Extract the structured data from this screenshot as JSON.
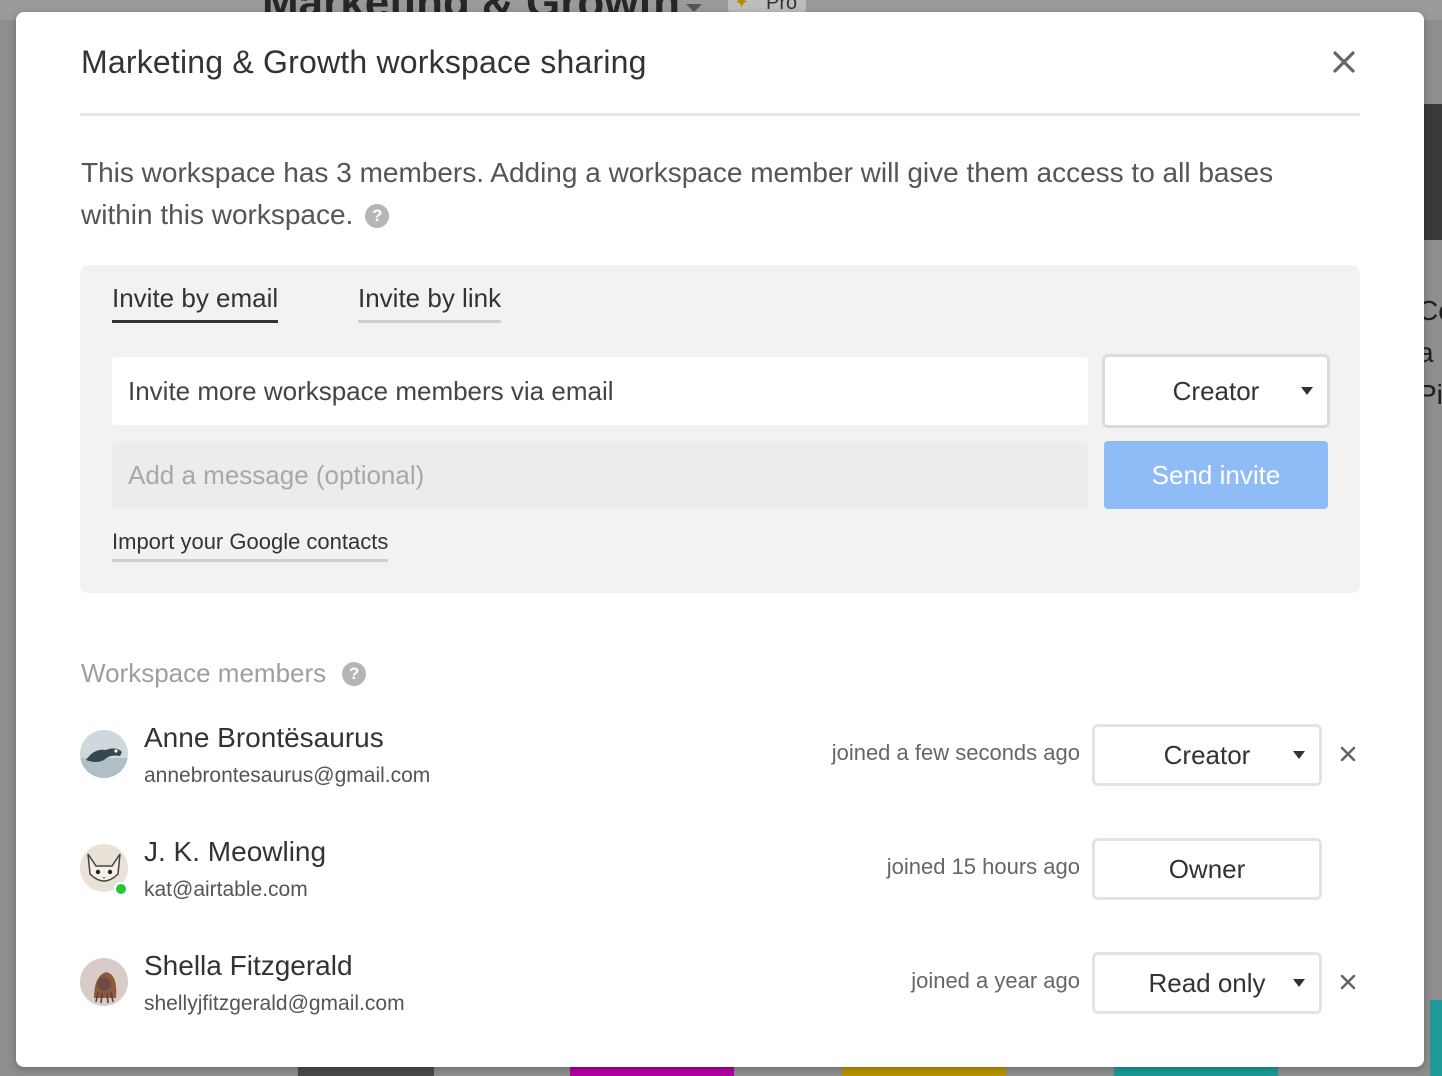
{
  "background": {
    "title": "Marketing & Growth",
    "plan_badge": "Pro",
    "right_fragments": [
      "Co",
      "a",
      "Pi"
    ]
  },
  "modal": {
    "title": "Marketing & Growth workspace sharing",
    "description": "This workspace has 3 members. Adding a workspace member will give them access to all bases within this workspace.",
    "help_icon": "?"
  },
  "invite": {
    "tabs": [
      {
        "label": "Invite by email",
        "active": true
      },
      {
        "label": "Invite by link",
        "active": false
      }
    ],
    "email_placeholder": "Invite more workspace members via email",
    "role": "Creator",
    "message_placeholder": "Add a message (optional)",
    "send_label": "Send invite",
    "import_label": "Import your Google contacts"
  },
  "members_section": {
    "heading": "Workspace members",
    "members": [
      {
        "name": "Anne Brontësaurus",
        "email": "annebrontesaurus@gmail.com",
        "joined": "joined a few seconds ago",
        "role": "Creator",
        "removable": true,
        "online": false
      },
      {
        "name": "J. K. Meowling",
        "email": "kat@airtable.com",
        "joined": "joined 15 hours ago",
        "role": "Owner",
        "removable": false,
        "online": true
      },
      {
        "name": "Shella Fitzgerald",
        "email": "shellyjfitzgerald@gmail.com",
        "joined": "joined a year ago",
        "role": "Read only",
        "removable": true,
        "online": false
      }
    ]
  },
  "colors": {
    "send_button": "#8fbcf6",
    "online": "#20c933",
    "panel": "#f2f2f2"
  }
}
